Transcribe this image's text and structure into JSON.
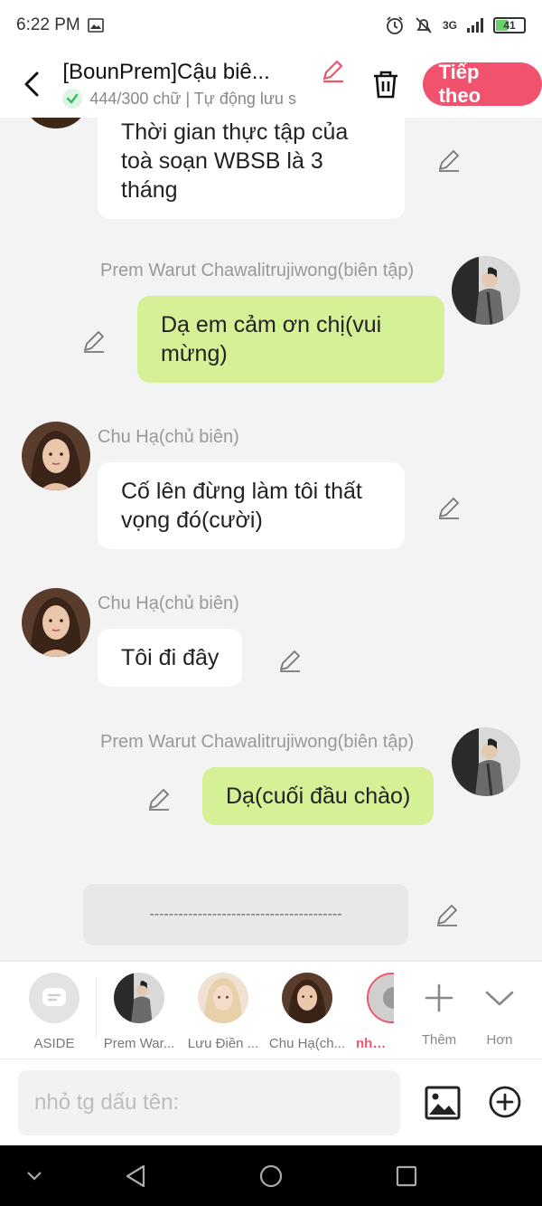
{
  "status": {
    "time": "6:22 PM",
    "network": "3G",
    "battery": "41"
  },
  "header": {
    "title": "[BounPrem]Cậu biê...",
    "word_count": "444/300 chữ | Tự động lưu s",
    "next_label": "Tiếp theo"
  },
  "messages": [
    {
      "speaker": "",
      "text": "Thời gian thực tập của toà soạn WBSB là 3 tháng",
      "side": "left"
    },
    {
      "speaker": "Prem Warut Chawalitrujiwong(biên tập)",
      "text": "Dạ em cảm ơn chị(vui mừng)",
      "side": "right"
    },
    {
      "speaker": "Chu Hạ(chủ biên)",
      "text": "Cố lên đừng làm tôi thất vọng đó(cười)",
      "side": "left"
    },
    {
      "speaker": "Chu Hạ(chủ biên)",
      "text": "Tôi đi đây",
      "side": "left"
    },
    {
      "speaker": "Prem Warut Chawalitrujiwong(biên tập)",
      "text": "Dạ(cuối đầu chào)",
      "side": "right"
    }
  ],
  "aside_text": "----------------------------------------",
  "characters": [
    {
      "label": "ASIDE"
    },
    {
      "label": "Prem War..."
    },
    {
      "label": "Lưu Điền ..."
    },
    {
      "label": "Chu Hạ(ch..."
    },
    {
      "label": "nhỏ tg"
    }
  ],
  "tools": {
    "add_label": "Thêm",
    "more_label": "Hơn"
  },
  "input": {
    "placeholder": "nhỏ tg dấu tên:"
  },
  "colors": {
    "accent": "#f1536e",
    "right_bubble": "#d5f095",
    "left_bubble": "#ffffff",
    "background": "#f3f3f3"
  }
}
